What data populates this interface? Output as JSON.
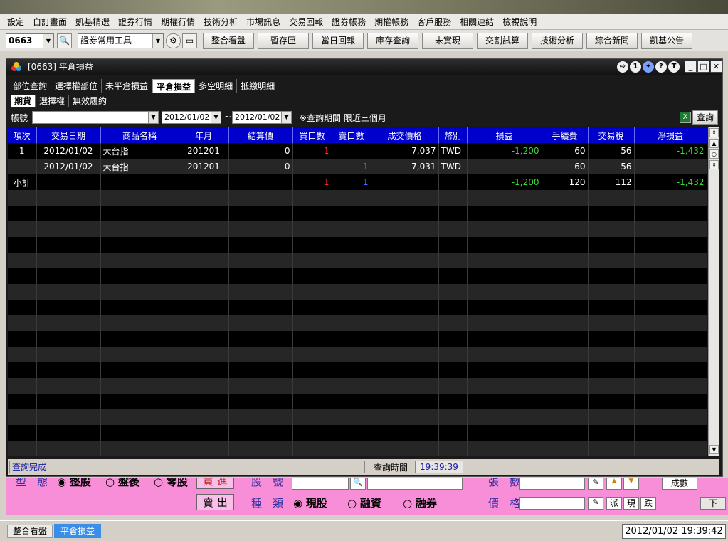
{
  "menu": [
    "設定",
    "自訂畫面",
    "凱基精選",
    "證券行情",
    "期權行情",
    "技術分析",
    "市場訊息",
    "交易回報",
    "證券帳務",
    "期權帳務",
    "客戶服務",
    "相關連結",
    "檢視說明"
  ],
  "toolbar": {
    "code_value": "0663",
    "tool_select": "證券常用工具",
    "buttons": [
      "整合看盤",
      "暫存匣",
      "當日回報",
      "庫存查詢",
      "未實現",
      "交割試算",
      "技術分析",
      "綜合新聞",
      "凱基公告"
    ]
  },
  "window": {
    "title": "[0663] 平倉損益",
    "title_icons": [
      "1",
      "?",
      "T"
    ],
    "tabs": [
      "部位查詢",
      "選擇權部位",
      "未平倉損益",
      "平倉損益",
      "多空明細",
      "抵繳明細"
    ],
    "active_tab": "平倉損益",
    "subtabs": [
      "期貨",
      "選擇權",
      "無效履約"
    ],
    "active_subtab": "期貨"
  },
  "query": {
    "account_label": "帳號",
    "account_value": "",
    "date_from": "2012/01/02",
    "tilde": "~",
    "date_to": "2012/01/02",
    "note": "※查詢期間 限近三個月",
    "query_button": "查詢"
  },
  "table": {
    "headers": [
      "項次",
      "交易日期",
      "商品名稱",
      "年月",
      "結算價",
      "買口數",
      "賣口數",
      "成交價格",
      "幣別",
      "損益",
      "手續費",
      "交易稅",
      "淨損益"
    ],
    "rows": [
      [
        "1",
        "2012/01/02",
        "大台指",
        "201201",
        "0",
        "1",
        "",
        "7,037",
        "TWD",
        "-1,200",
        "60",
        "56",
        "-1,432"
      ],
      [
        "",
        "2012/01/02",
        "大台指",
        "201201",
        "0",
        "",
        "1",
        "7,031",
        "TWD",
        "",
        "60",
        "56",
        ""
      ],
      [
        "小計",
        "",
        "",
        "",
        "",
        "1",
        "1",
        "",
        "",
        "-1,200",
        "120",
        "112",
        "-1,432"
      ]
    ],
    "empty_rows": 17
  },
  "status": {
    "message": "查詢完成",
    "time_label": "查詢時間",
    "time_value": "19:39:39"
  },
  "order_panel": {
    "row1": [
      "型　態",
      "整股",
      "盤後",
      "零股",
      "買 進",
      "股　號",
      "張　數",
      "成數"
    ],
    "row2": [
      "賣 出",
      "種　類",
      "現股",
      "融資",
      "融券",
      "價　格",
      "派",
      "現",
      "跌",
      "下"
    ]
  },
  "bottom": {
    "tabs": [
      "整合看盤",
      "平倉損益"
    ],
    "active_tab": "平倉損益",
    "clock": "2012/01/02 19:39:42"
  }
}
